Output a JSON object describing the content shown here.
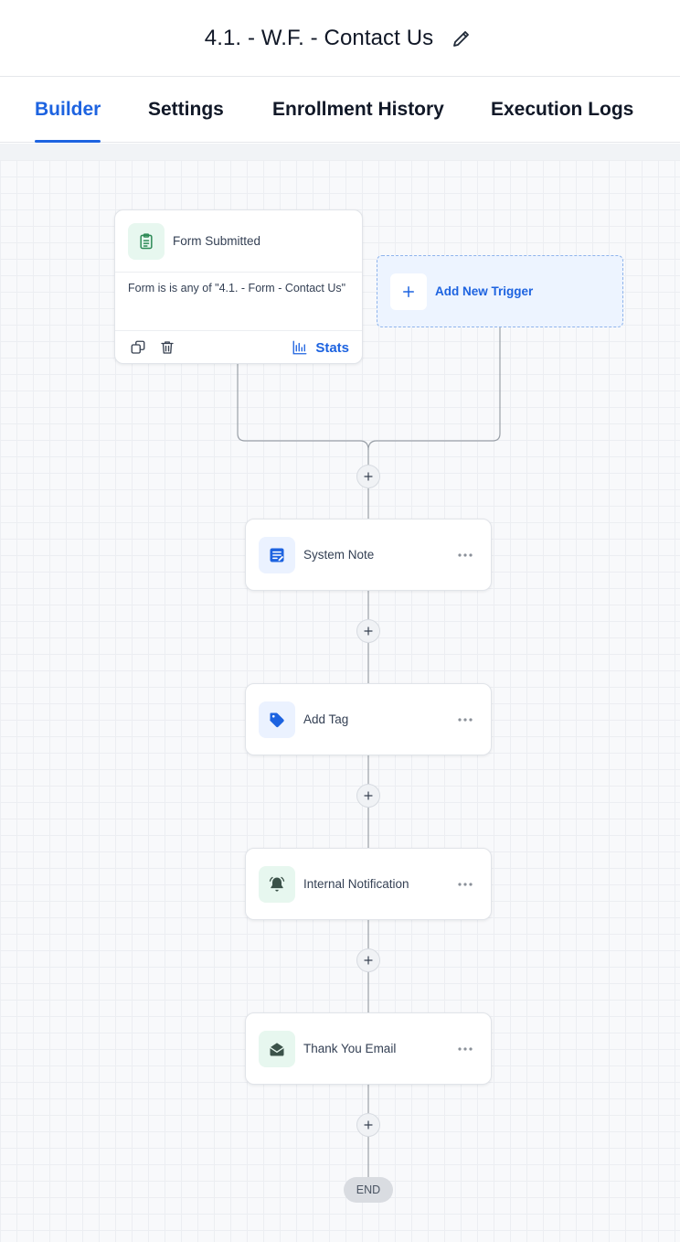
{
  "header": {
    "title": "4.1. - W.F. - Contact Us"
  },
  "tabs": [
    {
      "label": "Builder",
      "active": true
    },
    {
      "label": "Settings",
      "active": false
    },
    {
      "label": "Enrollment History",
      "active": false
    },
    {
      "label": "Execution Logs",
      "active": false
    }
  ],
  "trigger": {
    "title": "Form Submitted",
    "condition": "Form is is any of \"4.1. - Form - Contact Us\"",
    "stats_label": "Stats",
    "icon": "clipboard-icon"
  },
  "add_trigger": {
    "label": "Add New Trigger"
  },
  "actions": [
    {
      "title": "System Note",
      "icon": "note-icon"
    },
    {
      "title": "Add Tag",
      "icon": "tag-icon"
    },
    {
      "title": "Internal Notification",
      "icon": "bell-icon"
    },
    {
      "title": "Thank You Email",
      "icon": "envelope-open-icon"
    }
  ],
  "end_label": "END",
  "colors": {
    "accent": "#1d63e0",
    "green_icon": "#2e8b57",
    "dark_icon": "#3b5249"
  }
}
